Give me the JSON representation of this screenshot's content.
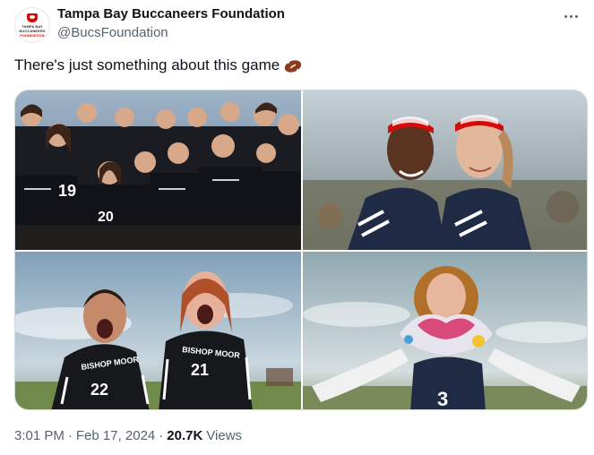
{
  "tweet": {
    "author_name": "Tampa Bay Buccaneers Foundation",
    "author_handle": "@BucsFoundation",
    "avatar_text": [
      "TAMPA BAY",
      "BUCCANEERS",
      "FOUNDATION"
    ],
    "text": "There's just something about this game",
    "emoji": "american-football-emoji",
    "time": "3:01 PM",
    "separator": "·",
    "date": "Feb 17, 2024",
    "views_count": "20.7K",
    "views_label": "Views"
  },
  "photos": [
    {
      "alt_name": "team-group-photo",
      "jersey_numbers": [
        "19",
        "20"
      ]
    },
    {
      "alt_name": "two-players-back-to-back-photo"
    },
    {
      "alt_name": "two-players-shouting-photo",
      "jersey_texts": [
        "BISHOP MOOR",
        "22",
        "BISHOP MOOR",
        "21"
      ]
    },
    {
      "alt_name": "player-heart-hands-photo",
      "jersey_numbers": [
        "3"
      ]
    }
  ],
  "colors": {
    "text_primary": "#0f1419",
    "text_secondary": "#536471",
    "border": "#cfd9de",
    "brand_red": "#d50a0a"
  }
}
